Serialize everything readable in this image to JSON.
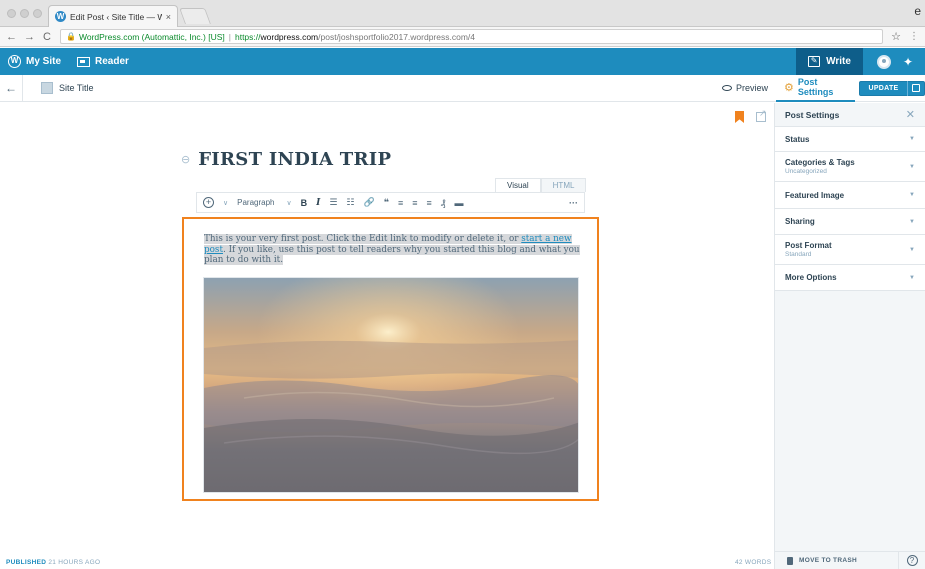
{
  "browser": {
    "tab_title": "Edit Post ‹ Site Title — WordPr",
    "tab_close": "×",
    "secure_label": "WordPress.com (Automattic, Inc.) [US]",
    "url_separator": "|",
    "url_prefix": "https://",
    "url_domain": "wordpress.com",
    "url_path": "/post/joshsportfolio2017.wordpress.com/4",
    "profile_glyph": "e"
  },
  "masterbar": {
    "my_site": "My Site",
    "reader": "Reader",
    "write": "Write"
  },
  "editor_bar": {
    "site_title": "Site Title",
    "preview": "Preview",
    "post_settings": "Post Settings",
    "update": "UPDATE"
  },
  "post": {
    "title": "FIRST INDIA TRIP",
    "mode_tabs": [
      "Visual",
      "HTML"
    ],
    "format_select": "Paragraph",
    "body_before_link": "This is your very first post. Click the Edit link to modify or delete it, or ",
    "body_link": "start a new post",
    "body_after_link": ". If you like, use this post to tell readers why you started this blog and what you plan to do with it."
  },
  "sidebar": {
    "header": "Post Settings",
    "items": [
      {
        "label": "Status",
        "sub": ""
      },
      {
        "label": "Categories & Tags",
        "sub": "Uncategorized"
      },
      {
        "label": "Featured Image",
        "sub": ""
      },
      {
        "label": "Sharing",
        "sub": ""
      },
      {
        "label": "Post Format",
        "sub": "Standard"
      },
      {
        "label": "More Options",
        "sub": ""
      }
    ],
    "trash": "MOVE TO TRASH"
  },
  "footer": {
    "published_label": "PUBLISHED",
    "published_time": "21 HOURS AGO",
    "word_count": "42 WORDS"
  },
  "colors": {
    "masterbar_blue": "#1e8cbe",
    "accent_orange": "#f0821e",
    "sidebar_bg": "#f3f6f8"
  }
}
